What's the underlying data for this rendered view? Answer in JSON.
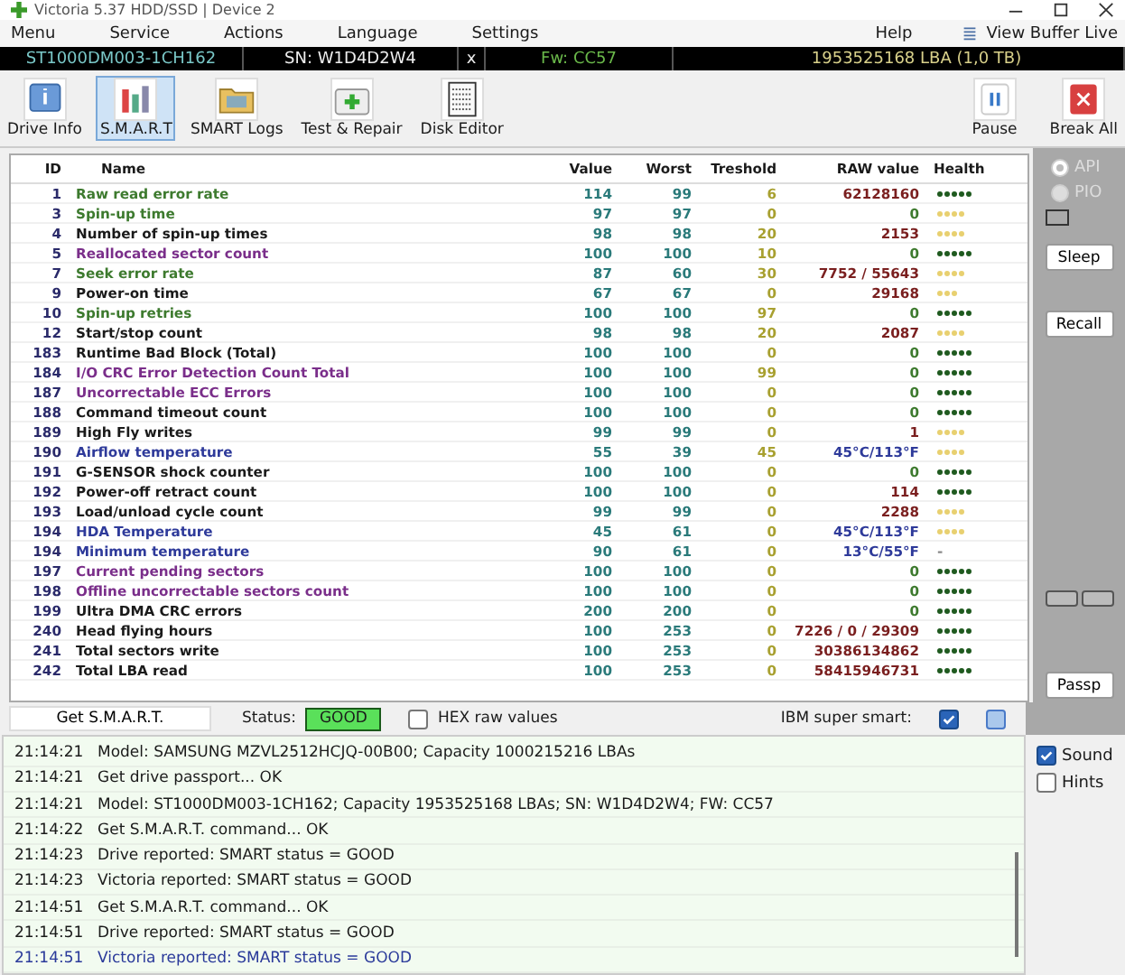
{
  "window": {
    "title": "Victoria 5.37 HDD/SSD | Device 2"
  },
  "menu": {
    "left": [
      "Menu",
      "Service",
      "Actions",
      "Language",
      "Settings"
    ],
    "right": [
      "Help"
    ],
    "view_buffer": "View Buffer Live"
  },
  "drive_bar": {
    "model": "ST1000DM003-1CH162",
    "serial": "SN: W1D4D2W4",
    "eject": "x",
    "firmware": "Fw: CC57",
    "capacity": "1953525168 LBA (1,0 TB)"
  },
  "toolbar": {
    "tabs": [
      {
        "label": "Drive Info",
        "kind": "info",
        "selected": false
      },
      {
        "label": "S.M.A.R.T",
        "kind": "smart",
        "selected": true
      },
      {
        "label": "SMART Logs",
        "kind": "logs",
        "selected": false
      },
      {
        "label": "Test & Repair",
        "kind": "repair",
        "selected": false
      },
      {
        "label": "Disk Editor",
        "kind": "editor",
        "selected": false
      }
    ],
    "actions": [
      {
        "label": "Pause",
        "kind": "pause"
      },
      {
        "label": "Break All",
        "kind": "break"
      }
    ]
  },
  "table": {
    "columns": [
      "ID",
      "Name",
      "Value",
      "Worst",
      "Treshold",
      "RAW value",
      "Health"
    ],
    "rows": [
      {
        "id": "1",
        "name": "Raw read error rate",
        "color": "#3d7a2e",
        "value": "114",
        "worst": "99",
        "threshold": "6",
        "raw": {
          "text": "62128160",
          "color": "#7a1f1f"
        },
        "stars": 5
      },
      {
        "id": "3",
        "name": "Spin-up time",
        "color": "#3d7a2e",
        "value": "97",
        "worst": "97",
        "threshold": "0",
        "raw": {
          "text": "0",
          "color": "#3d7a2e"
        },
        "stars": 4
      },
      {
        "id": "4",
        "name": "Number of spin-up times",
        "color": "#1a1a1a",
        "value": "98",
        "worst": "98",
        "threshold": "20",
        "raw": {
          "text": "2153",
          "color": "#7a1f1f"
        },
        "stars": 4
      },
      {
        "id": "5",
        "name": "Reallocated sector count",
        "color": "#7a2e8a",
        "value": "100",
        "worst": "100",
        "threshold": "10",
        "raw": {
          "text": "0",
          "color": "#3d7a2e"
        },
        "stars": 5
      },
      {
        "id": "7",
        "name": "Seek error rate",
        "color": "#3d7a2e",
        "value": "87",
        "worst": "60",
        "threshold": "30",
        "raw": {
          "text": "7752 / 55643",
          "color": "#7a1f1f"
        },
        "stars": 4
      },
      {
        "id": "9",
        "name": "Power-on time",
        "color": "#1a1a1a",
        "value": "67",
        "worst": "67",
        "threshold": "0",
        "raw": {
          "text": "29168",
          "color": "#7a1f1f"
        },
        "stars": 3
      },
      {
        "id": "10",
        "name": "Spin-up retries",
        "color": "#3d7a2e",
        "value": "100",
        "worst": "100",
        "threshold": "97",
        "raw": {
          "text": "0",
          "color": "#3d7a2e"
        },
        "stars": 5
      },
      {
        "id": "12",
        "name": "Start/stop count",
        "color": "#1a1a1a",
        "value": "98",
        "worst": "98",
        "threshold": "20",
        "raw": {
          "text": "2087",
          "color": "#7a1f1f"
        },
        "stars": 4
      },
      {
        "id": "183",
        "name": "Runtime Bad Block (Total)",
        "color": "#1a1a1a",
        "value": "100",
        "worst": "100",
        "threshold": "0",
        "raw": {
          "text": "0",
          "color": "#3d7a2e"
        },
        "stars": 5
      },
      {
        "id": "184",
        "name": "I/O CRC Error Detection Count Total",
        "color": "#7a2e8a",
        "value": "100",
        "worst": "100",
        "threshold": "99",
        "raw": {
          "text": "0",
          "color": "#3d7a2e"
        },
        "stars": 5
      },
      {
        "id": "187",
        "name": "Uncorrectable ECC Errors",
        "color": "#7a2e8a",
        "value": "100",
        "worst": "100",
        "threshold": "0",
        "raw": {
          "text": "0",
          "color": "#3d7a2e"
        },
        "stars": 5
      },
      {
        "id": "188",
        "name": "Command timeout count",
        "color": "#1a1a1a",
        "value": "100",
        "worst": "100",
        "threshold": "0",
        "raw": {
          "text": "0",
          "color": "#3d7a2e"
        },
        "stars": 5
      },
      {
        "id": "189",
        "name": "High Fly writes",
        "color": "#1a1a1a",
        "value": "99",
        "worst": "99",
        "threshold": "0",
        "raw": {
          "text": "1",
          "color": "#7a1f1f"
        },
        "stars": 4
      },
      {
        "id": "190",
        "name": "Airflow temperature",
        "color": "#2e3a9a",
        "value": "55",
        "worst": "39",
        "threshold": "45",
        "raw": {
          "text": "45°C/113°F",
          "color": "#2e3a9a"
        },
        "stars": 4
      },
      {
        "id": "191",
        "name": "G-SENSOR shock counter",
        "color": "#1a1a1a",
        "value": "100",
        "worst": "100",
        "threshold": "0",
        "raw": {
          "text": "0",
          "color": "#3d7a2e"
        },
        "stars": 5
      },
      {
        "id": "192",
        "name": "Power-off retract count",
        "color": "#1a1a1a",
        "value": "100",
        "worst": "100",
        "threshold": "0",
        "raw": {
          "text": "114",
          "color": "#7a1f1f"
        },
        "stars": 5
      },
      {
        "id": "193",
        "name": "Load/unload cycle count",
        "color": "#1a1a1a",
        "value": "99",
        "worst": "99",
        "threshold": "0",
        "raw": {
          "text": "2288",
          "color": "#7a1f1f"
        },
        "stars": 4
      },
      {
        "id": "194",
        "name": "HDA Temperature",
        "color": "#2e3a9a",
        "value": "45",
        "worst": "61",
        "threshold": "0",
        "raw": {
          "text": "45°C/113°F",
          "color": "#2e3a9a"
        },
        "stars": 4
      },
      {
        "id": "194",
        "name": "Minimum temperature",
        "color": "#2e3a9a",
        "value": "90",
        "worst": "61",
        "threshold": "0",
        "raw": {
          "text": "13°C/55°F",
          "color": "#2e3a9a"
        },
        "health_text": "-"
      },
      {
        "id": "197",
        "name": "Current pending sectors",
        "color": "#7a2e8a",
        "value": "100",
        "worst": "100",
        "threshold": "0",
        "raw": {
          "text": "0",
          "color": "#3d7a2e"
        },
        "stars": 5
      },
      {
        "id": "198",
        "name": "Offline uncorrectable sectors count",
        "color": "#7a2e8a",
        "value": "100",
        "worst": "100",
        "threshold": "0",
        "raw": {
          "text": "0",
          "color": "#3d7a2e"
        },
        "stars": 5
      },
      {
        "id": "199",
        "name": "Ultra DMA CRC errors",
        "color": "#1a1a1a",
        "value": "200",
        "worst": "200",
        "threshold": "0",
        "raw": {
          "text": "0",
          "color": "#3d7a2e"
        },
        "stars": 5
      },
      {
        "id": "240",
        "name": "Head flying hours",
        "color": "#1a1a1a",
        "value": "100",
        "worst": "253",
        "threshold": "0",
        "raw": {
          "text": "7226 / 0 / 29309",
          "color": "#7a1f1f"
        },
        "stars": 5
      },
      {
        "id": "241",
        "name": "Total sectors write",
        "color": "#1a1a1a",
        "value": "100",
        "worst": "253",
        "threshold": "0",
        "raw": {
          "text": "30386134862",
          "color": "#7a1f1f"
        },
        "stars": 5
      },
      {
        "id": "242",
        "name": "Total LBA read",
        "color": "#1a1a1a",
        "value": "100",
        "worst": "253",
        "threshold": "0",
        "raw": {
          "text": "58415946731",
          "color": "#7a1f1f"
        },
        "stars": 5
      }
    ]
  },
  "side_panel": {
    "radios": [
      {
        "label": "API",
        "selected": true,
        "disabled": true
      },
      {
        "label": "PIO",
        "selected": false,
        "disabled": true
      }
    ],
    "buttons": [
      "Sleep",
      "Recall",
      "Passp"
    ]
  },
  "bottom_bar": {
    "get_button": "Get S.M.A.R.T.",
    "status_label": "Status:",
    "status": "GOOD",
    "hex": {
      "label": "HEX raw values",
      "checked": false
    },
    "ibm": {
      "label": "IBM super smart:",
      "checked": true
    },
    "extra_checked": false
  },
  "log": [
    {
      "time": "21:14:21",
      "text": "Model: SAMSUNG MZVL2512HCJQ-00B00; Capacity 1000215216 LBAs",
      "selected": false
    },
    {
      "time": "21:14:21",
      "text": "Get drive passport... OK",
      "selected": false
    },
    {
      "time": "21:14:21",
      "text": "Model: ST1000DM003-1CH162; Capacity 1953525168 LBAs; SN: W1D4D2W4; FW: CC57",
      "selected": false
    },
    {
      "time": "21:14:22",
      "text": "Get S.M.A.R.T. command... OK",
      "selected": false
    },
    {
      "time": "21:14:23",
      "text": "Drive reported: SMART status = GOOD",
      "selected": false
    },
    {
      "time": "21:14:23",
      "text": "Victoria reported: SMART status = GOOD",
      "selected": false
    },
    {
      "time": "21:14:51",
      "text": "Get S.M.A.R.T. command... OK",
      "selected": false
    },
    {
      "time": "21:14:51",
      "text": "Drive reported: SMART status = GOOD",
      "selected": false
    },
    {
      "time": "21:14:51",
      "text": "Victoria reported: SMART status = GOOD",
      "selected": true
    }
  ],
  "options": [
    {
      "label": "Sound",
      "checked": true
    },
    {
      "label": "Hints",
      "checked": false
    }
  ]
}
